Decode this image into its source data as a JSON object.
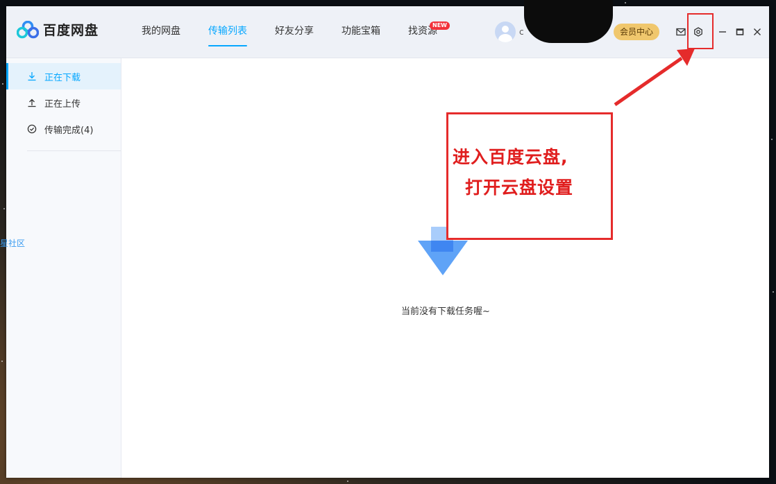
{
  "app": {
    "name": "百度网盘"
  },
  "nav": {
    "items": [
      {
        "label": "我的网盘"
      },
      {
        "label": "传输列表"
      },
      {
        "label": "好友分享"
      },
      {
        "label": "功能宝箱"
      },
      {
        "label": "找资源"
      }
    ],
    "new_badge": "NEW",
    "active_index": 1
  },
  "header": {
    "username": "c",
    "vip_label": "会员中心",
    "icons": [
      "mail-icon",
      "settings-icon",
      "minimize-icon",
      "maximize-icon",
      "close-icon"
    ]
  },
  "sidebar": {
    "items": [
      {
        "label": "正在下载",
        "icon": "download-icon"
      },
      {
        "label": "正在上传",
        "icon": "upload-icon"
      },
      {
        "label": "传输完成(4)",
        "icon": "check-circle-icon"
      }
    ],
    "active_index": 0,
    "community_link": "星社区"
  },
  "main": {
    "empty_text": "当前没有下载任务喔~"
  },
  "annotation": {
    "line1": "进入百度云盘,",
    "line2": "打开云盘设置"
  },
  "colors": {
    "accent": "#06a7ff",
    "vip": "#f0c76d",
    "annotation_red": "#e52b2b",
    "badge_red": "#f2323a"
  }
}
